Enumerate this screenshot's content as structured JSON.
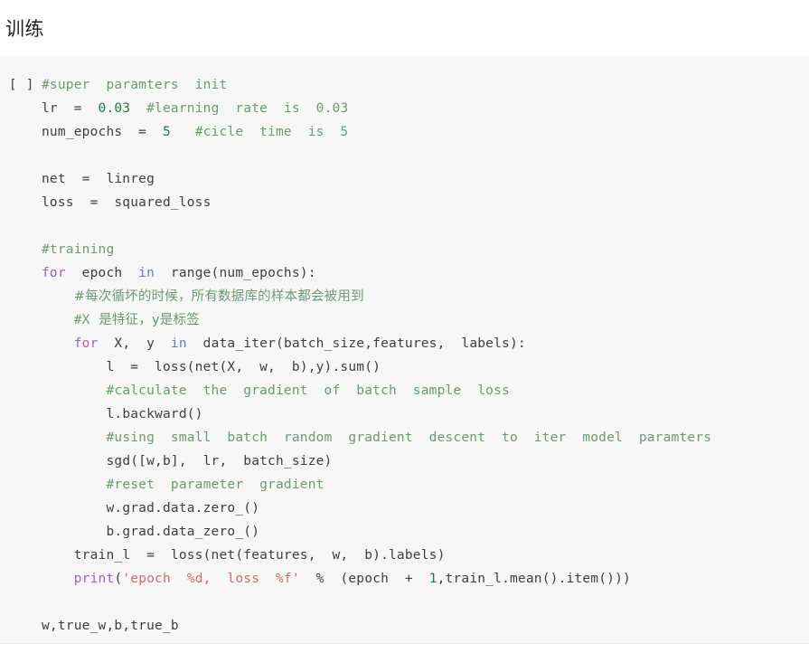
{
  "heading": {
    "title": "训练"
  },
  "cell": {
    "run_indicator": "[ ]",
    "lines": [
      {
        "id": "line-1",
        "indent": 0,
        "tokens": [
          {
            "kind": "comment",
            "text": "#super  paramters  init"
          }
        ]
      },
      {
        "id": "line-2",
        "indent": 0,
        "tokens": [
          {
            "kind": "plain",
            "text": "lr  =  "
          },
          {
            "kind": "number",
            "text": "0.03"
          },
          {
            "kind": "plain",
            "text": "  "
          },
          {
            "kind": "comment",
            "text": "#learning  rate  is  0.03"
          }
        ]
      },
      {
        "id": "line-3",
        "indent": 0,
        "tokens": [
          {
            "kind": "plain",
            "text": "num_epochs  =  "
          },
          {
            "kind": "number",
            "text": "5"
          },
          {
            "kind": "plain",
            "text": "   "
          },
          {
            "kind": "comment",
            "text": "#cicle  time  is  5"
          }
        ]
      },
      {
        "id": "line-4",
        "indent": 0,
        "blank": true,
        "tokens": []
      },
      {
        "id": "line-5",
        "indent": 0,
        "tokens": [
          {
            "kind": "plain",
            "text": "net  =  linreg"
          }
        ]
      },
      {
        "id": "line-6",
        "indent": 0,
        "tokens": [
          {
            "kind": "plain",
            "text": "loss  =  squared_loss"
          }
        ]
      },
      {
        "id": "line-7",
        "indent": 0,
        "blank": true,
        "tokens": []
      },
      {
        "id": "line-8",
        "indent": 0,
        "tokens": [
          {
            "kind": "comment",
            "text": "#training"
          }
        ]
      },
      {
        "id": "line-9",
        "indent": 0,
        "tokens": [
          {
            "kind": "keyword",
            "text": "for"
          },
          {
            "kind": "plain",
            "text": "  epoch  "
          },
          {
            "kind": "keyword2",
            "text": "in"
          },
          {
            "kind": "plain",
            "text": "  range(num_epochs):"
          }
        ]
      },
      {
        "id": "line-10",
        "indent": 1,
        "tokens": [
          {
            "kind": "comment_cn",
            "text": "#每次循坏的时候，所有数据库的样本都会被用到"
          }
        ]
      },
      {
        "id": "line-11",
        "indent": 1,
        "tokens": [
          {
            "kind": "comment",
            "text": "#X"
          },
          {
            "kind": "comment_cn",
            "text": "  是特征，y是标签"
          }
        ]
      },
      {
        "id": "line-12",
        "indent": 1,
        "tokens": [
          {
            "kind": "keyword",
            "text": "for"
          },
          {
            "kind": "plain",
            "text": "  X,  y  "
          },
          {
            "kind": "keyword2",
            "text": "in"
          },
          {
            "kind": "plain",
            "text": "  data_iter(batch_size,features,  labels):"
          }
        ]
      },
      {
        "id": "line-13",
        "indent": 2,
        "tokens": [
          {
            "kind": "plain",
            "text": "l  =  loss(net(X,  w,  b),y).sum()"
          }
        ]
      },
      {
        "id": "line-14",
        "indent": 2,
        "tokens": [
          {
            "kind": "comment",
            "text": "#calculate  the  gradient  of  batch  sample  loss"
          }
        ]
      },
      {
        "id": "line-15",
        "indent": 2,
        "tokens": [
          {
            "kind": "plain",
            "text": "l.backward()"
          }
        ]
      },
      {
        "id": "line-16",
        "indent": 2,
        "tokens": [
          {
            "kind": "comment",
            "text": "#using  small  batch  random  gradient  descent  to  iter  model  paramters"
          }
        ]
      },
      {
        "id": "line-17",
        "indent": 2,
        "tokens": [
          {
            "kind": "plain",
            "text": "sgd([w,b],  lr,  batch_size)"
          }
        ]
      },
      {
        "id": "line-18",
        "indent": 2,
        "tokens": [
          {
            "kind": "comment",
            "text": "#reset  parameter  gradient"
          }
        ]
      },
      {
        "id": "line-19",
        "indent": 2,
        "tokens": [
          {
            "kind": "plain",
            "text": "w.grad.data.zero_()"
          }
        ]
      },
      {
        "id": "line-20",
        "indent": 2,
        "tokens": [
          {
            "kind": "plain",
            "text": "b.grad.data_zero_()"
          }
        ]
      },
      {
        "id": "line-21",
        "indent": 1,
        "tokens": [
          {
            "kind": "plain",
            "text": "train_l  =  loss(net(features,  w,  b).labels)"
          }
        ]
      },
      {
        "id": "line-22",
        "indent": 1,
        "tokens": [
          {
            "kind": "keyword",
            "text": "print"
          },
          {
            "kind": "plain",
            "text": "("
          },
          {
            "kind": "string",
            "text": "'epoch  %d,  loss  %f'"
          },
          {
            "kind": "plain",
            "text": "  %  (epoch  +  "
          },
          {
            "kind": "number",
            "text": "1"
          },
          {
            "kind": "plain",
            "text": ",train_l.mean().item()))"
          }
        ]
      },
      {
        "id": "line-23",
        "indent": 0,
        "blank": true,
        "tokens": []
      },
      {
        "id": "line-24",
        "indent": 0,
        "tokens": [
          {
            "kind": "plain",
            "text": "w,true_w,b,true_b"
          }
        ]
      }
    ]
  },
  "colors": {
    "page_background": "#ffffff",
    "cell_background": "#f7f7f7",
    "cell_border": "#ececec",
    "text": "#3c4043",
    "comment": "#6d9a73",
    "keyword": "#9a62c9",
    "keyword_in": "#6a78c8",
    "number": "#1a7f4b",
    "string": "#cf6b6b"
  }
}
